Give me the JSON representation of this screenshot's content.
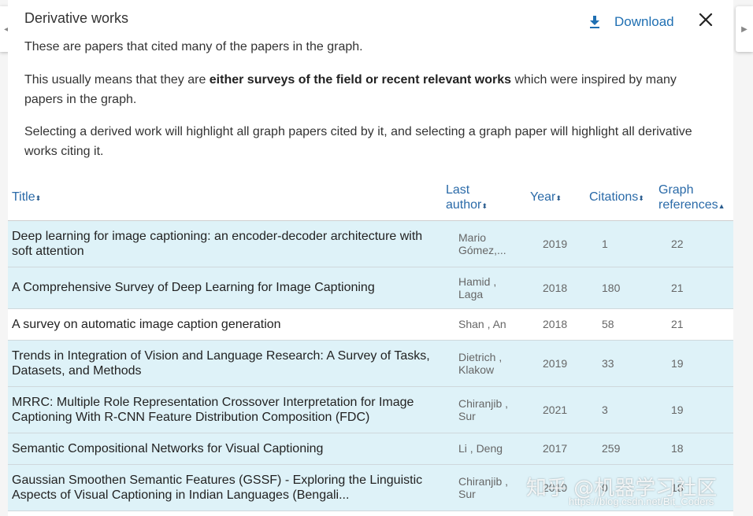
{
  "panel": {
    "title": "Derivative works",
    "download_label": "Download",
    "close_label": "×"
  },
  "description": {
    "p1": "These are papers that cited many of the papers in the graph.",
    "p2_before": "This usually means that they are ",
    "p2_bold": "either surveys of the field or recent relevant works",
    "p2_after": " which were inspired by many papers in the graph.",
    "p3": "Selecting a derived work will highlight all graph papers cited by it, and selecting a graph paper will highlight all derivative works citing it."
  },
  "table": {
    "headers": {
      "title": "Title",
      "last_author_line1": "Last",
      "last_author_line2": "author",
      "year": "Year",
      "citations": "Citations",
      "graph_refs_line1": "Graph",
      "graph_refs_line2": "references"
    },
    "sort_both": "⬍",
    "sort_up": "▲",
    "rows": [
      {
        "title": "Deep learning for image captioning: an encoder-decoder architecture with soft attention",
        "author": "Mario Gómez,...",
        "year": "2019",
        "citations": "1",
        "graph_references": "22"
      },
      {
        "title": "A Comprehensive Survey of Deep Learning for Image Captioning",
        "author": "Hamid , Laga",
        "year": "2018",
        "citations": "180",
        "graph_references": "21"
      },
      {
        "title": "A survey on automatic image caption generation",
        "author": "Shan , An",
        "year": "2018",
        "citations": "58",
        "graph_references": "21"
      },
      {
        "title": "Trends in Integration of Vision and Language Research: A Survey of Tasks, Datasets, and Methods",
        "author": "Dietrich , Klakow",
        "year": "2019",
        "citations": "33",
        "graph_references": "19"
      },
      {
        "title": "MRRC: Multiple Role Representation Crossover Interpretation for Image Captioning With R-CNN Feature Distribution Composition (FDC)",
        "author": "Chiranjib , Sur",
        "year": "2021",
        "citations": "3",
        "graph_references": "19"
      },
      {
        "title": "Semantic Compositional Networks for Visual Captioning",
        "author": "Li , Deng",
        "year": "2017",
        "citations": "259",
        "graph_references": "18"
      },
      {
        "title": "Gaussian Smoothen Semantic Features (GSSF) - Exploring the Linguistic Aspects of Visual Captioning in Indian Languages (Bengali...",
        "author": "Chiranjib , Sur",
        "year": "2019",
        "citations": "0",
        "graph_references": "18"
      }
    ]
  },
  "nav": {
    "left_arrow": "◀",
    "right_arrow": "▶"
  },
  "watermark": {
    "text": "知乎 @机器学习社区",
    "url": "https://blog.csdn.net/Bit_Coders"
  },
  "colors": {
    "link_blue": "#2a6aa8",
    "row_highlight": "#def2f8"
  }
}
